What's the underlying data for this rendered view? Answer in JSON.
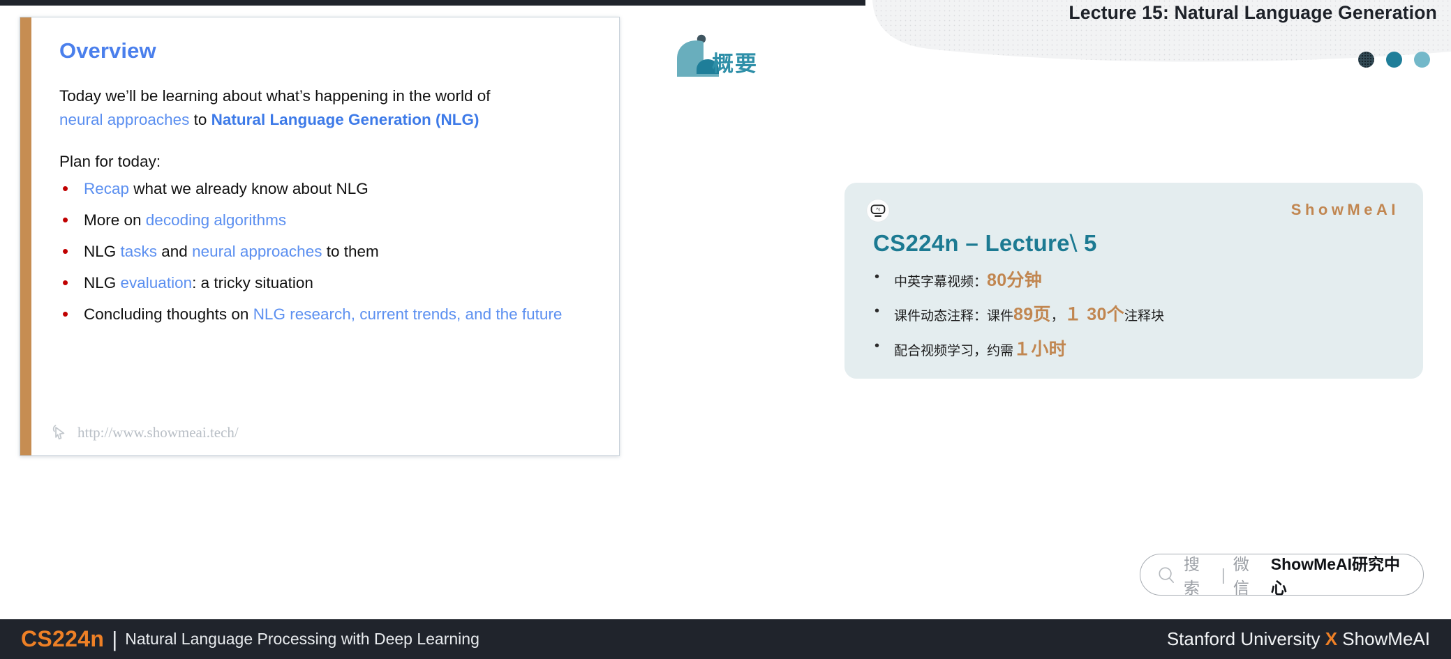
{
  "slide": {
    "title": "Overview",
    "lead": {
      "line1": "Today we’ll be learning about what’s happening in the world of",
      "part_blue": "neural approaches",
      "part_to": " to ",
      "part_bluebold": "Natural Language Generation (NLG)"
    },
    "plan_heading": "Plan for today:",
    "bullets": [
      {
        "blue1": "Recap",
        "black1": " what we already know about NLG"
      },
      {
        "black1": "More on ",
        "blue1": "decoding algorithms"
      },
      {
        "black1": "NLG ",
        "blue1": "tasks",
        "black2": " and ",
        "blue2": "neural approaches",
        "black3": " to them"
      },
      {
        "black1": "NLG ",
        "blue1": "evaluation",
        "black2": ": a tricky situation"
      },
      {
        "black1": "Concluding thoughts on ",
        "blue1": "NLG research, current trends, and the future"
      }
    ],
    "watermark_url": "http://www.showmeai.tech/",
    "watermark_icon": "cursor-icon"
  },
  "notes": {
    "header_title": "Lecture 15: Natural Language Generation",
    "section_heading": "概要",
    "dots": [
      {
        "name": "dot-halftone",
        "color": "#334a55"
      },
      {
        "name": "dot-solid",
        "color": "#1f7e99"
      },
      {
        "name": "dot-light",
        "color": "#73b8c9"
      }
    ],
    "mascot_icon": "mascot-shape-icon",
    "card": {
      "robot_icon": "ai-robot-icon",
      "brand": "ShowMeAI",
      "title": "CS224n – Lecture⧵ 5",
      "items": [
        {
          "pre": "中英字幕视频：",
          "hl": "80分钟",
          "post": ""
        },
        {
          "pre": "课件动态注释：课件",
          "hl": "89页",
          "mid": "，",
          "hl2": "１ 30个",
          "post": "注释块"
        },
        {
          "pre": "配合视频学习，约需",
          "hl": "１小时",
          "post": ""
        }
      ]
    },
    "search": {
      "icon": "search-icon",
      "placeholder": "搜索",
      "divider": "|",
      "channel": "微信",
      "account": "ShowMeAI研究中心"
    }
  },
  "footer": {
    "course_code": "CS224n",
    "divider": "|",
    "course_name": "Natural Language Processing with Deep Learning",
    "right_pre": "Stanford University ",
    "right_x": "X",
    "right_post": " ShowMeAI"
  },
  "colors": {
    "accent_blue": "#4a7fec",
    "bullet_red": "#c00000",
    "slide_bar": "#c68d52",
    "teal": "#1c7a92",
    "bronze": "#c18650",
    "orange": "#ee8026",
    "footer_bg": "#20242c"
  }
}
